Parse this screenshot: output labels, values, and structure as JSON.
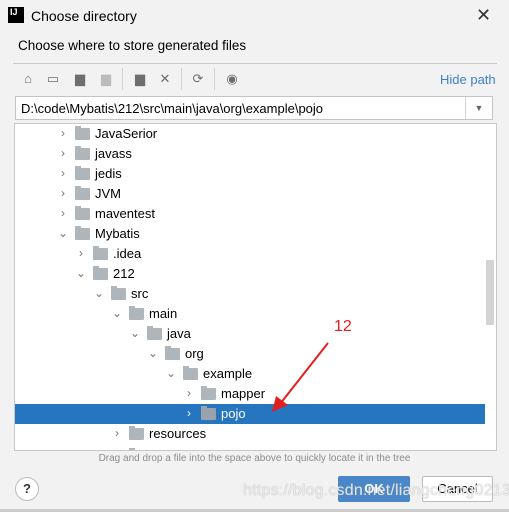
{
  "window": {
    "title": "Choose directory",
    "logo": "IJ",
    "close_icon": "close-icon"
  },
  "subtitle": "Choose where to store generated files",
  "toolbar": {
    "icons": [
      "home-icon",
      "desktop-icon",
      "project-folder-icon",
      "module-folder-icon",
      "new-folder-icon",
      "delete-icon",
      "refresh-icon",
      "show-hidden-icon"
    ],
    "hide_path": "Hide path"
  },
  "path": {
    "value": "D:\\code\\Mybatis\\212\\src\\main\\java\\org\\example\\pojo"
  },
  "tree": {
    "items": [
      {
        "label": "JavaSerior",
        "level": 0,
        "expanded": false
      },
      {
        "label": "javass",
        "level": 0,
        "expanded": false
      },
      {
        "label": "jedis",
        "level": 0,
        "expanded": false
      },
      {
        "label": "JVM",
        "level": 0,
        "expanded": false
      },
      {
        "label": "maventest",
        "level": 0,
        "expanded": false
      },
      {
        "label": "Mybatis",
        "level": 0,
        "expanded": true
      },
      {
        "label": ".idea",
        "level": 1,
        "expanded": false
      },
      {
        "label": "212",
        "level": 1,
        "expanded": true
      },
      {
        "label": "src",
        "level": 2,
        "expanded": true
      },
      {
        "label": "main",
        "level": 3,
        "expanded": true
      },
      {
        "label": "java",
        "level": 4,
        "expanded": true
      },
      {
        "label": "org",
        "level": 5,
        "expanded": true
      },
      {
        "label": "example",
        "level": 6,
        "expanded": true
      },
      {
        "label": "mapper",
        "level": 7,
        "expanded": false
      },
      {
        "label": "pojo",
        "level": 7,
        "expanded": false,
        "selected": true
      },
      {
        "label": "resources",
        "level": 3,
        "expanded": false
      }
    ]
  },
  "hint": "Drag and drop a file into the space above to quickly locate it in the tree",
  "buttons": {
    "help": "?",
    "ok": "OK",
    "cancel": "Cancel"
  },
  "annotation": {
    "text": "12",
    "color": "#e02020"
  },
  "watermark": "https://blog.csdn.net/liangcheng0213",
  "colors": {
    "selection": "#2675bf",
    "link": "#3d7fd2",
    "ok": "#4a87c8"
  }
}
